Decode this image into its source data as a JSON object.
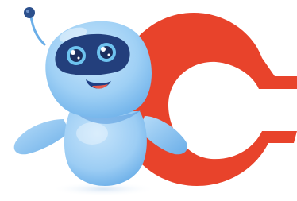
{
  "illustration": {
    "subject": "robot-mascot",
    "logo_shape": "c-shaped-logo",
    "colors": {
      "logo_red": "#e8432b",
      "robot_body_light": "#a9d5f6",
      "robot_body_mid": "#7fbcef",
      "robot_body_dark": "#4d8fd6",
      "visor": "#233f7c",
      "eyes": "#6ec3ef",
      "antenna_ball": "#2b4f8c",
      "cheeks": "#ffffff",
      "mouth": "#1f3f86",
      "tongue": "#e85a4a",
      "shadow": "#dfeaf6"
    }
  }
}
